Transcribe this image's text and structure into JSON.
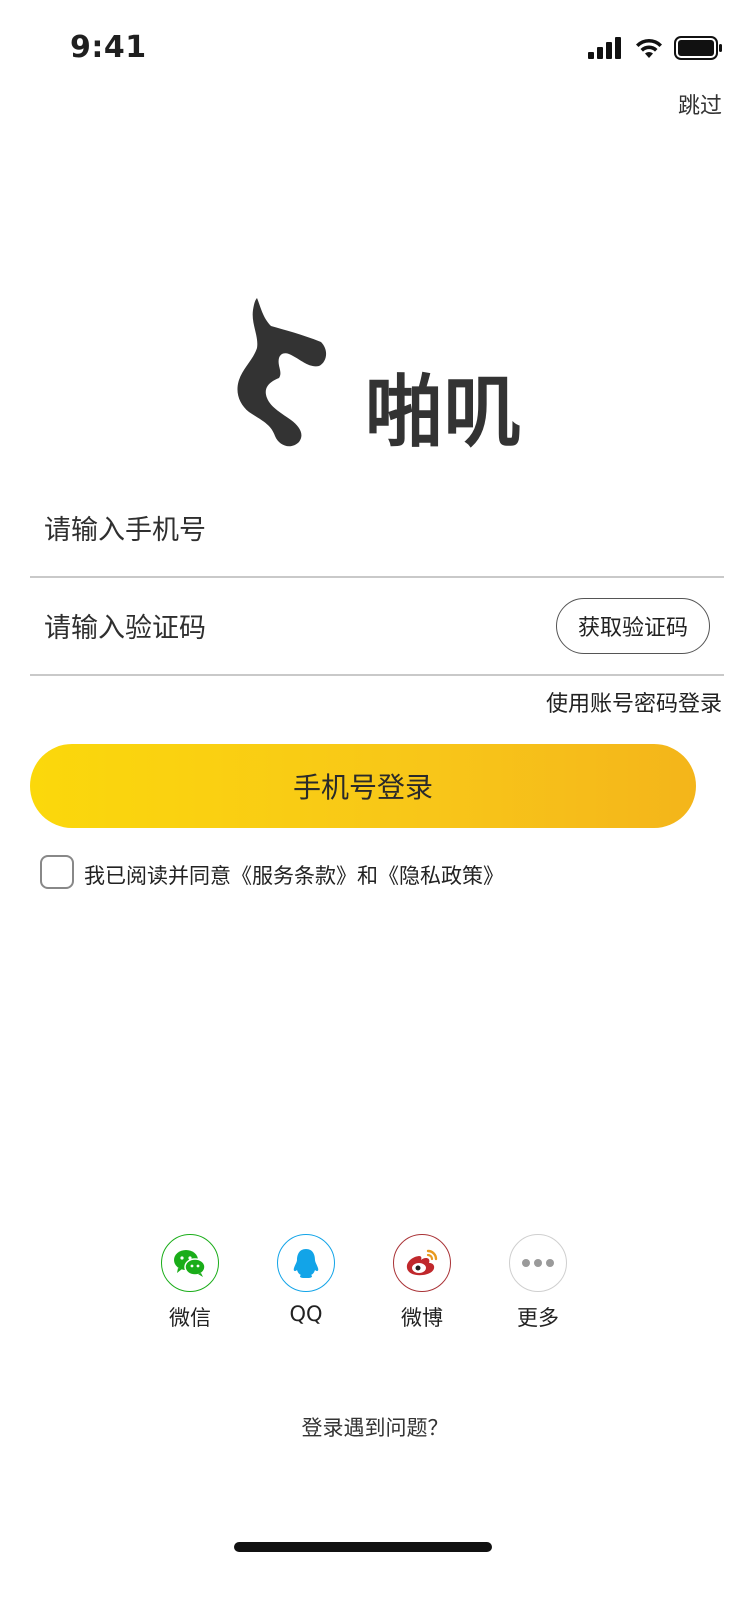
{
  "status_bar": {
    "time": "9:41"
  },
  "header": {
    "skip_label": "跳过"
  },
  "logo": {
    "text": "啪叽"
  },
  "form": {
    "phone_placeholder": "请输入手机号",
    "code_placeholder": "请输入验证码",
    "get_code_label": "获取验证码",
    "password_login_label": "使用账号密码登录",
    "login_button_label": "手机号登录"
  },
  "agreement": {
    "checked": false,
    "text": "我已阅读并同意《服务条款》和《隐私政策》"
  },
  "social_login": {
    "items": [
      {
        "label": "微信",
        "icon": "wechat-icon",
        "color": "#1aad19"
      },
      {
        "label": "QQ",
        "icon": "qq-icon",
        "color": "#12a4e8"
      },
      {
        "label": "微博",
        "icon": "weibo-icon",
        "color": "#c0282c"
      },
      {
        "label": "更多",
        "icon": "more-icon",
        "color": "#999999"
      }
    ]
  },
  "footer": {
    "help_label": "登录遇到问题？"
  },
  "colors": {
    "accent_start": "#fbd80b",
    "accent_end": "#f4b51a",
    "logo": "#333333"
  }
}
